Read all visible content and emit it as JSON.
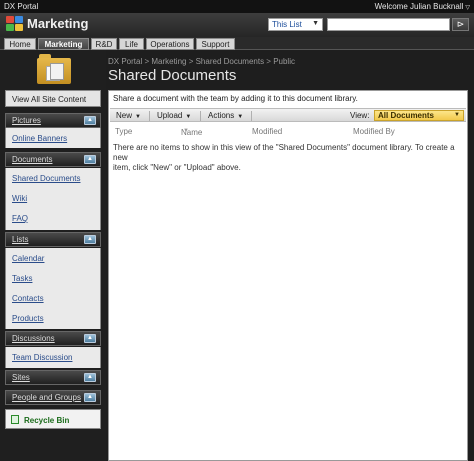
{
  "topbar": {
    "portal": "DX Portal",
    "welcome": "Welcome Julian Bucknall"
  },
  "header": {
    "site_title": "Marketing",
    "scope": "This List",
    "search_value": "",
    "search_button": "⊳"
  },
  "nav_tabs": [
    "Home",
    "Marketing",
    "R&D",
    "Life",
    "Operations",
    "Support"
  ],
  "leftnav": {
    "view_all": "View All Site Content",
    "pictures": "Pictures",
    "online_banners": "Online Banners",
    "documents": "Documents",
    "shared_documents": "Shared Documents",
    "wiki": "Wiki",
    "faq": "FAQ",
    "lists": "Lists",
    "calendar": "Calendar",
    "tasks": "Tasks",
    "contacts": "Contacts",
    "products": "Products",
    "discussions": "Discussions",
    "team_discussion": "Team Discussion",
    "sites": "Sites",
    "people_and_groups": "People and Groups",
    "recycle_bin": "Recycle Bin"
  },
  "page": {
    "breadcrumb": "DX Portal > Marketing > Shared Documents > Public",
    "title": "Shared Documents",
    "description": "Share a document with the team by adding it to this document library."
  },
  "toolbar": {
    "new": "New",
    "upload": "Upload",
    "actions": "Actions",
    "view_label": "View:",
    "view_value": "All Documents"
  },
  "columns": [
    "Type",
    "Name",
    "Modified",
    "Modified By"
  ],
  "empty_line1": "There are no items to show in this view of the \"Shared Documents\" document library. To create a new",
  "empty_line2": "item, click \"New\" or \"Upload\" above.",
  "colors": {
    "accent": "#f2c94c",
    "nav_link": "#2a4c8a",
    "recycle": "#1a6b1a"
  }
}
